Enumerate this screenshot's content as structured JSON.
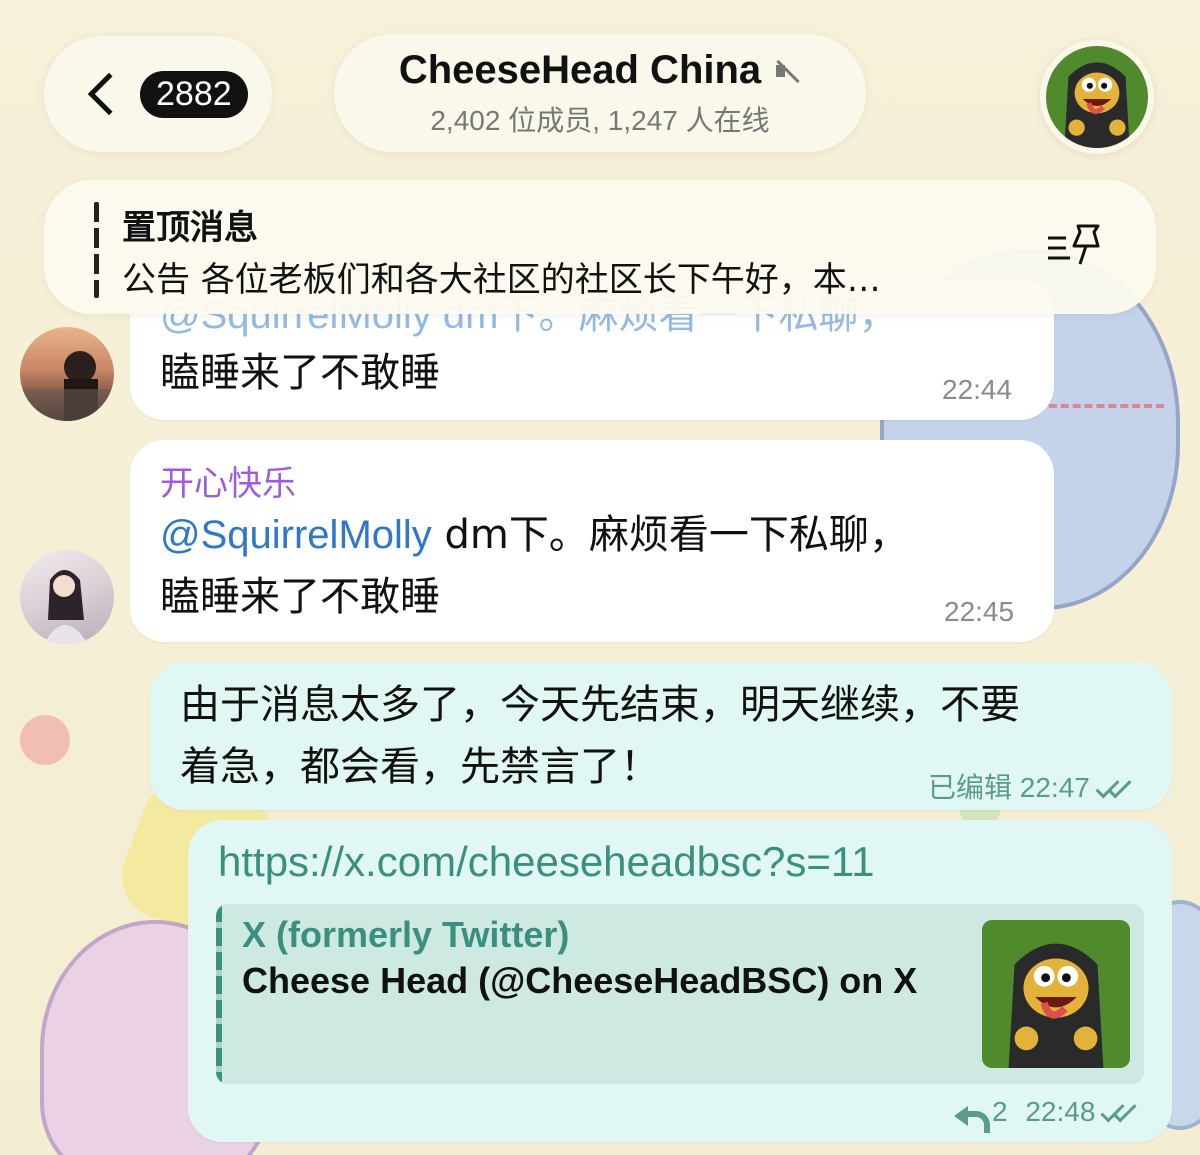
{
  "header": {
    "unread_count": "2882",
    "chat_title": "CheeseHead China",
    "chat_subtitle": "2,402 位成员, 1,247 人在线"
  },
  "pinned": {
    "title": "置顶消息",
    "text": "公告 各位老板们和各大社区的社区长下午好，本…"
  },
  "messages": [
    {
      "id": "msg-1",
      "partial_top": "@SquirrelMolly dm下。麻烦看一下私聊，",
      "text": "瞌睡来了不敢睡",
      "time": "22:44"
    },
    {
      "id": "msg-2",
      "sender": "开心快乐",
      "mention": "@SquirrelMolly",
      "line1_rest": "dm下。麻烦看一下私聊，",
      "line2": "瞌睡来了不敢睡",
      "time": "22:45"
    },
    {
      "id": "msg-3",
      "line1": "由于消息太多了，今天先结束，明天继续，不要",
      "line2": "着急，都会看，先禁言了！",
      "edited_label": "已编辑",
      "time": "22:47"
    },
    {
      "id": "msg-4",
      "url": "https://x.com/cheeseheadbsc?s=11",
      "preview_site": "X (formerly Twitter)",
      "preview_title": "Cheese Head (@CheeseHeadBSC) on X",
      "reply_count": "2",
      "time": "22:48"
    }
  ],
  "colors": {
    "outgoing_bubble": "#e0f7f4",
    "incoming_bubble": "#ffffff",
    "sender_name": "#9d5ce0",
    "mention": "#2e78c7",
    "link": "#3b8f7e"
  },
  "icons": [
    "back-chevron-icon",
    "mute-icon",
    "pin-list-icon",
    "double-check-icon",
    "reply-icon"
  ]
}
